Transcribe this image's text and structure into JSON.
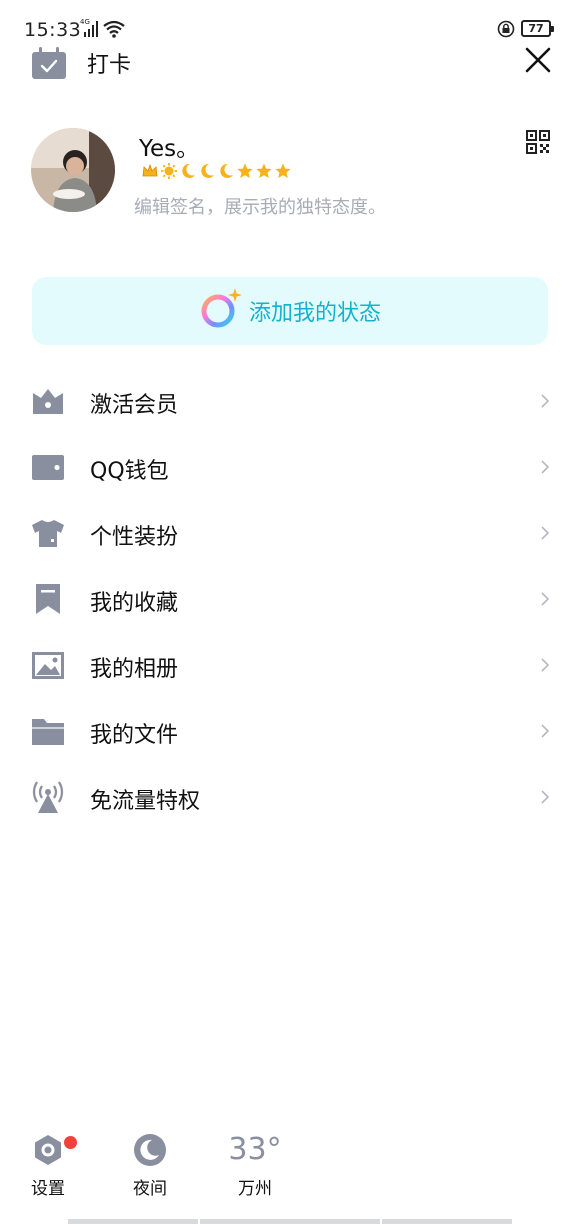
{
  "status_bar": {
    "time": "15:33",
    "network": "4G",
    "battery": "77"
  },
  "header": {
    "checkin_label": "打卡"
  },
  "profile": {
    "nickname": "Yes。",
    "signature": "编辑签名，展示我的独特态度。"
  },
  "status_banner": {
    "label": "添加我的状态"
  },
  "menu": [
    {
      "label": "激活会员",
      "icon": "vip-icon"
    },
    {
      "label": "QQ钱包",
      "icon": "wallet-icon"
    },
    {
      "label": "个性装扮",
      "icon": "tshirt-icon"
    },
    {
      "label": "我的收藏",
      "icon": "bookmark-icon"
    },
    {
      "label": "我的相册",
      "icon": "photo-icon"
    },
    {
      "label": "我的文件",
      "icon": "folder-icon"
    },
    {
      "label": "免流量特权",
      "icon": "signal-tower-icon"
    }
  ],
  "bottom": {
    "settings_label": "设置",
    "night_label": "夜间",
    "temperature": "33°",
    "city": "万州"
  },
  "colors": {
    "icon_gray": "#8a8fa0",
    "accent": "#14b2cd",
    "banner_bg": "#e3fbfc",
    "notify_red": "#f2403a"
  }
}
